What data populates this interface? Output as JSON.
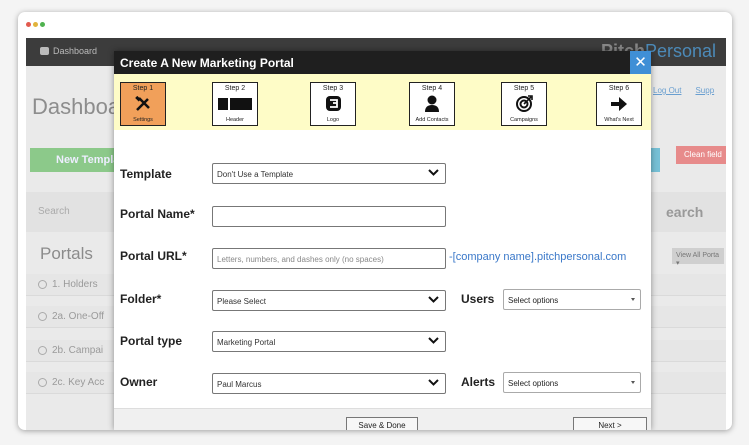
{
  "background": {
    "nav_dashboard": "Dashboard",
    "brand_part1": "Pitch",
    "brand_part2": "Personal",
    "link_logout": "Log Out",
    "link_support": "Supp",
    "page_title": "Dashboa",
    "new_template_button": "New Templa",
    "clean_button": "Clean field",
    "search_placeholder": "Search",
    "search_heading": "earch",
    "portals_heading": "Portals",
    "view_all": "View All Porta",
    "portal_rows": [
      "1. Holders",
      "2a. One-Off",
      "2b. Campai",
      "2c. Key Acc"
    ]
  },
  "modal": {
    "title": "Create A New Marketing Portal",
    "close_label": "✕",
    "steps": [
      {
        "name": "Step 1",
        "label": "Settings",
        "icon": "tools-icon",
        "active": true
      },
      {
        "name": "Step 2",
        "label": "Header",
        "icon": "header-icon",
        "active": false
      },
      {
        "name": "Step 3",
        "label": "Logo",
        "icon": "logo-icon",
        "active": false
      },
      {
        "name": "Step 4",
        "label": "Add Contacts",
        "icon": "person-icon",
        "active": false
      },
      {
        "name": "Step 5",
        "label": "Campaigns",
        "icon": "target-icon",
        "active": false
      },
      {
        "name": "Step 6",
        "label": "What's Next",
        "icon": "arrow-right-icon",
        "active": false
      }
    ],
    "form": {
      "template_label": "Template",
      "template_value": "Don't Use a Template",
      "portal_name_label": "Portal Name*",
      "portal_name_value": "",
      "portal_url_label": "Portal URL*",
      "portal_url_placeholder": "Letters, numbers, and dashes only (no spaces)",
      "portal_url_suffix": "-[company name].pitchpersonal.com",
      "folder_label": "Folder*",
      "folder_value": "Please Select",
      "users_label": "Users",
      "users_value": "Select options",
      "portal_type_label": "Portal type",
      "portal_type_value": "Marketing Portal",
      "owner_label": "Owner",
      "owner_value": "Paul Marcus",
      "alerts_label": "Alerts",
      "alerts_value": "Select options"
    },
    "buttons": {
      "save_done": "Save & Done",
      "next": "Next >"
    }
  }
}
